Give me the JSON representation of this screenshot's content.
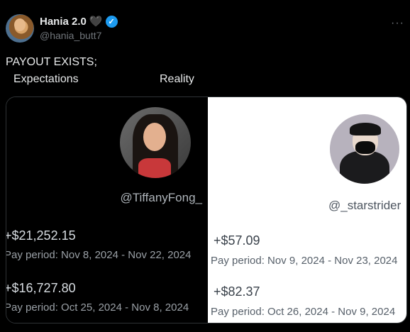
{
  "author": {
    "display_name": "Hania 2.0",
    "heart": "🖤",
    "verified_mark": "✓",
    "handle": "@hania_butt7",
    "more_icon": "···"
  },
  "tweet": {
    "text": "PAYOUT EXISTS;",
    "label_left": "Expectations",
    "label_right": "Reality"
  },
  "media": {
    "left": {
      "handle": "@TiffanyFong_",
      "payouts": [
        {
          "amount": "+$21,252.15",
          "period": "Pay period: Nov 8, 2024 - Nov 22, 2024"
        },
        {
          "amount": "+$16,727.80",
          "period": "Pay period: Oct 25, 2024 - Nov 8, 2024"
        }
      ]
    },
    "right": {
      "handle": "@_starstrider",
      "payouts": [
        {
          "amount": "+$57.09",
          "period": "Pay period: Nov 9, 2024 - Nov 23, 2024"
        },
        {
          "amount": "+$82.37",
          "period": "Pay period: Oct 26, 2024 - Nov 9, 2024"
        }
      ]
    }
  },
  "colors": {
    "background": "#000000",
    "verified": "#1d9bf0",
    "secondary_text": "#71767b"
  }
}
